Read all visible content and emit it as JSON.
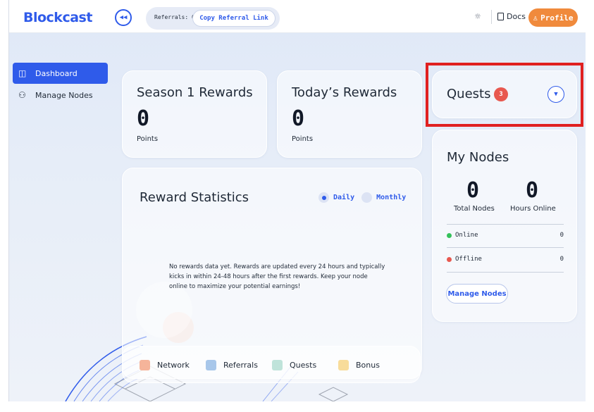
{
  "header": {
    "logo": "Blockcast",
    "referrals": "Referrals: 0",
    "copy_referral": "Copy Referral Link",
    "docs": "Docs",
    "profile": "Profile"
  },
  "sidebar": {
    "items": [
      {
        "label": "Dashboard",
        "active": true
      },
      {
        "label": "Manage Nodes",
        "active": false
      }
    ]
  },
  "season_card": {
    "title": "Season 1 Rewards",
    "value": "0",
    "unit": "Points"
  },
  "today_card": {
    "title": "Today’s Rewards",
    "value": "0",
    "unit": "Points"
  },
  "reward_stats": {
    "title": "Reward Statistics",
    "options": [
      "Daily",
      "Monthly"
    ],
    "selected": "Daily",
    "empty_message": "No rewards data yet. Rewards are updated every 24 hours and typically kicks in within 24-48 hours after the first rewards. Keep your node online to maximize your potential earnings!"
  },
  "legend": [
    {
      "label": "Network",
      "color": "#f5b49a"
    },
    {
      "label": "Referrals",
      "color": "#a8c7ea"
    },
    {
      "label": "Quests",
      "color": "#bfe3da"
    },
    {
      "label": "Bonus",
      "color": "#f8dc9a"
    }
  ],
  "quests": {
    "title": "Quests",
    "count": "3"
  },
  "my_nodes": {
    "title": "My Nodes",
    "total_nodes": "0",
    "total_nodes_label": "Total Nodes",
    "hours_online": "0",
    "hours_online_label": "Hours Online",
    "statuses": [
      {
        "label": "Online",
        "value": "0",
        "color": "#34c15a"
      },
      {
        "label": "Offline",
        "value": "0",
        "color": "#e8584f"
      }
    ],
    "manage_button": "Manage Nodes"
  },
  "colors": {
    "accent": "#2f5bea",
    "profile": "#f08a3c",
    "badge": "#e8584f",
    "highlight": "#e02020"
  },
  "icons": [
    "collapse-icon",
    "sun-icon",
    "doc-icon",
    "user-icon",
    "dashboard-icon",
    "nodes-icon",
    "chevron-down-icon"
  ]
}
